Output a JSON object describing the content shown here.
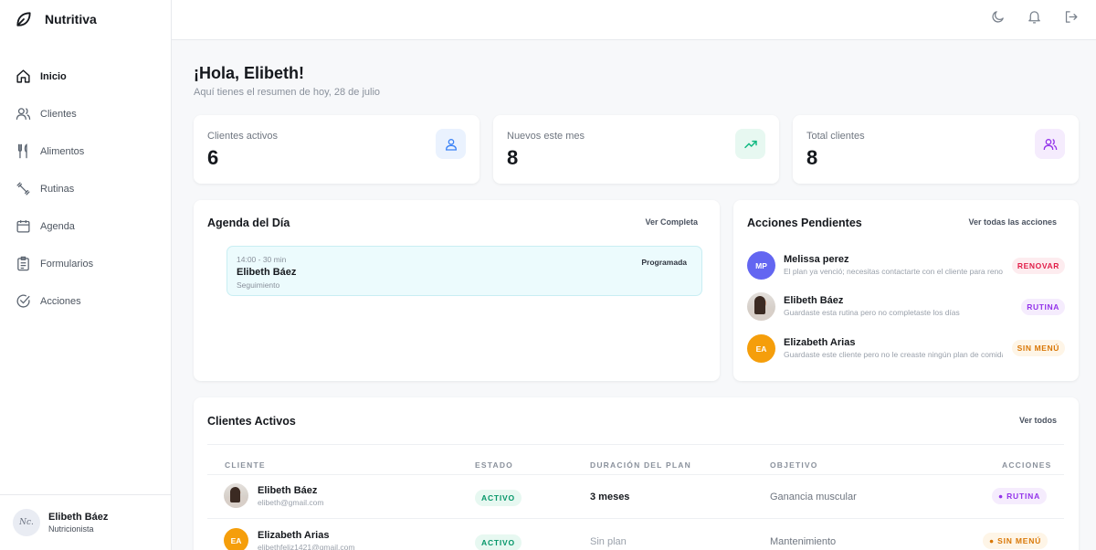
{
  "app": {
    "name": "Nutritiva"
  },
  "sidebar": {
    "items": [
      {
        "label": "Inicio",
        "icon": "home-icon",
        "active": true
      },
      {
        "label": "Clientes",
        "icon": "users-icon"
      },
      {
        "label": "Alimentos",
        "icon": "utensils-icon"
      },
      {
        "label": "Rutinas",
        "icon": "dumbbell-icon"
      },
      {
        "label": "Agenda",
        "icon": "calendar-icon"
      },
      {
        "label": "Formularios",
        "icon": "clipboard-icon"
      },
      {
        "label": "Acciones",
        "icon": "check-circle-icon"
      }
    ],
    "user": {
      "initials": "Nc.",
      "name": "Elibeth Báez",
      "role": "Nutricionista"
    }
  },
  "topbar": {
    "icons": [
      "moon-icon",
      "bell-icon",
      "logout-icon"
    ]
  },
  "header": {
    "greeting": "¡Hola, Elibeth!",
    "subtitle": "Aquí tienes el resumen de hoy, 28 de julio"
  },
  "stats": [
    {
      "label": "Clientes activos",
      "value": "6",
      "icon": "user-icon",
      "color": "#3b82f6",
      "bg": "#eaf2fe"
    },
    {
      "label": "Nuevos este mes",
      "value": "8",
      "icon": "trending-up-icon",
      "color": "#10b981",
      "bg": "#e7f8f1"
    },
    {
      "label": "Total clientes",
      "value": "8",
      "icon": "users-icon",
      "color": "#9333ea",
      "bg": "#f5ecfd"
    }
  ],
  "agenda": {
    "title": "Agenda del Día",
    "link": "Ver Completa",
    "events": [
      {
        "time": "14:00 - 30 min",
        "client": "Elibeth Báez",
        "type": "Seguimiento",
        "status": "Programada"
      }
    ]
  },
  "pending": {
    "title": "Acciones Pendientes",
    "link": "Ver todas las acciones",
    "items": [
      {
        "initials": "MP",
        "avatar_color": "#6366f1",
        "name": "Melissa perez",
        "desc": "El plan ya venció; necesitas contactarte con el cliente para renovarlo",
        "tag": "RENOVAR",
        "tag_color": "#e11d48",
        "tag_bg": "#fdecef"
      },
      {
        "initials": "",
        "avatar_color": "#d9d2cb",
        "name": "Elibeth Báez",
        "desc": "Guardaste esta rutina pero no completaste los días",
        "tag": "RUTINA",
        "tag_color": "#9333ea",
        "tag_bg": "#f5ecfd"
      },
      {
        "initials": "EA",
        "avatar_color": "#f59e0b",
        "name": "Elizabeth Arias",
        "desc": "Guardaste este cliente pero no le creaste ningún plan de comidas",
        "tag": "SIN MENÚ",
        "tag_color": "#d97706",
        "tag_bg": "#fef5e7"
      }
    ]
  },
  "clients": {
    "title": "Clientes Activos",
    "link": "Ver todos",
    "columns": [
      "CLIENTE",
      "ESTADO",
      "DURACIÓN DEL PLAN",
      "OBJETIVO",
      "ACCIONES"
    ],
    "rows": [
      {
        "initials": "",
        "name": "Elibeth Báez",
        "email": "elibeth@gmail.com",
        "status": "ACTIVO",
        "duration": "3 meses",
        "goal": "Ganancia muscular",
        "action": "RUTINA",
        "action_color": "#9333ea",
        "action_bg": "#f5ecfd"
      },
      {
        "initials": "EA",
        "name": "Elizabeth Arias",
        "email": "elibethfeliz1421@gmail.com",
        "status": "ACTIVO",
        "duration": "Sin plan",
        "goal": "Mantenimiento",
        "action": "SIN MENÚ",
        "action_color": "#d97706",
        "action_bg": "#fef5e7"
      }
    ]
  }
}
